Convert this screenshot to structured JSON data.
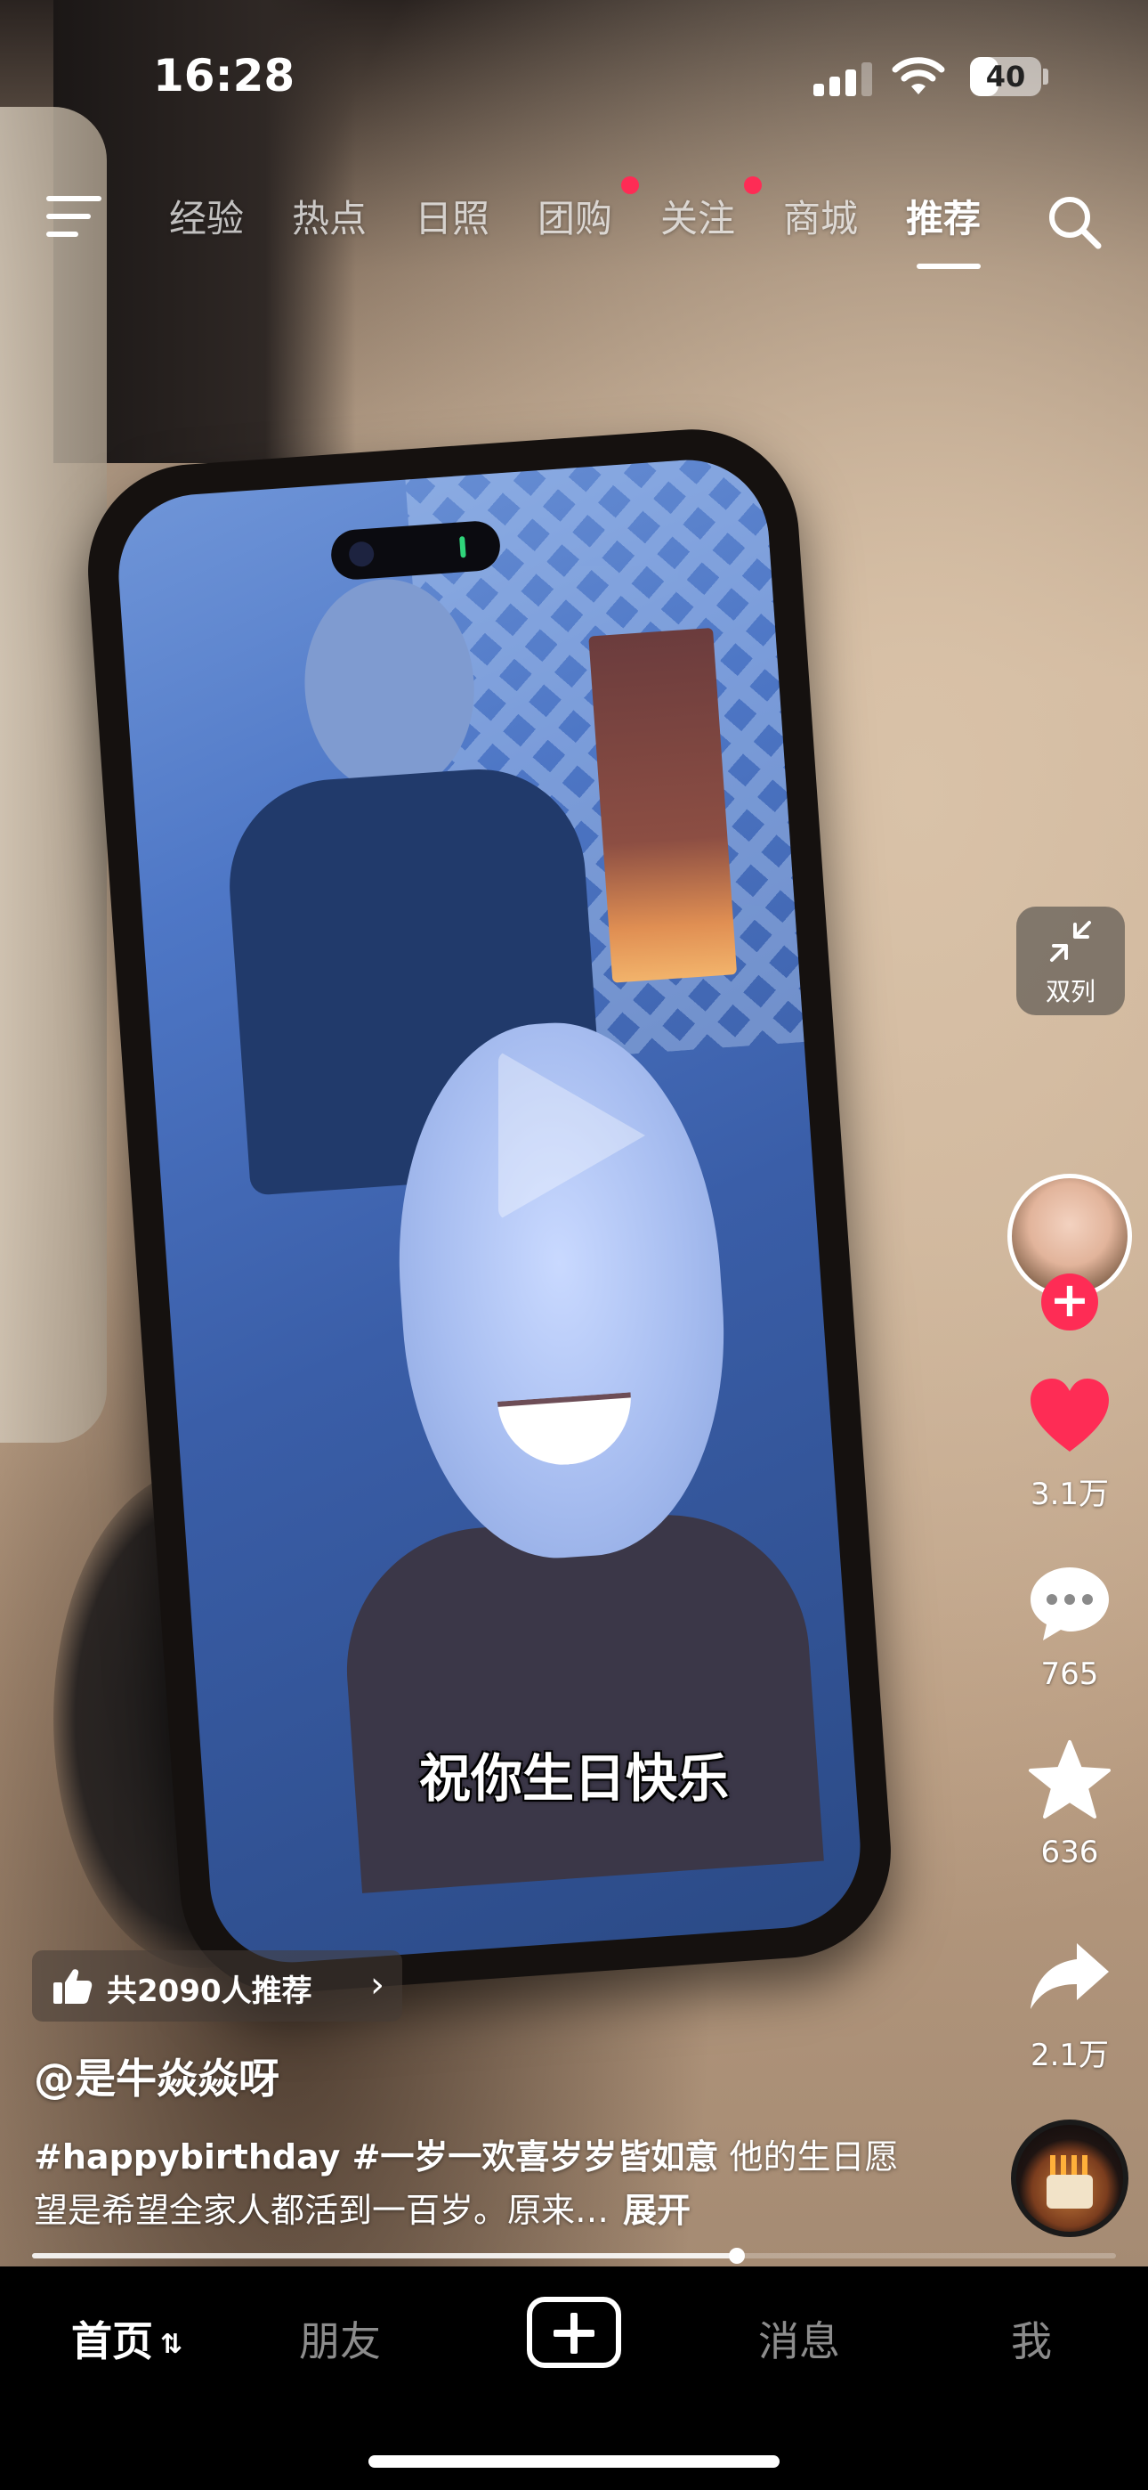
{
  "status_bar": {
    "time": "16:28",
    "battery": "40",
    "battery_level": 0.4,
    "signal_bars": 3
  },
  "top_nav": {
    "tabs": [
      {
        "label": "经验",
        "dot": false
      },
      {
        "label": "热点",
        "dot": false
      },
      {
        "label": "日照",
        "dot": false
      },
      {
        "label": "团购",
        "dot": true
      },
      {
        "label": "关注",
        "dot": true
      },
      {
        "label": "商城",
        "dot": false
      },
      {
        "label": "推荐",
        "dot": false,
        "active": true
      }
    ],
    "menu_icon": "menu-icon",
    "search_icon": "search-icon"
  },
  "video": {
    "subtitle": "祝你生日快乐",
    "play_icon": "play-icon"
  },
  "dual_column": {
    "label": "双列",
    "icon": "collapse-arrows-icon"
  },
  "actions": {
    "likes": "3.1万",
    "comments": "765",
    "favorites": "636",
    "shares": "2.1万"
  },
  "recommend": {
    "text": "共2090人推荐",
    "arrow": "›"
  },
  "post": {
    "author": "@是牛焱焱呀",
    "hashtags": "#happybirthday #一岁一欢喜岁岁皆如意",
    "text": " 他的生日愿望是希望全家人都活到一百岁。原来…",
    "expand": "展开"
  },
  "progress": {
    "fraction": 0.65
  },
  "tab_bar": {
    "home": "首页",
    "friends": "朋友",
    "messages": "消息",
    "me": "我"
  },
  "colors": {
    "accent": "#fe2c55",
    "tab_bar_bg": "#000000"
  }
}
